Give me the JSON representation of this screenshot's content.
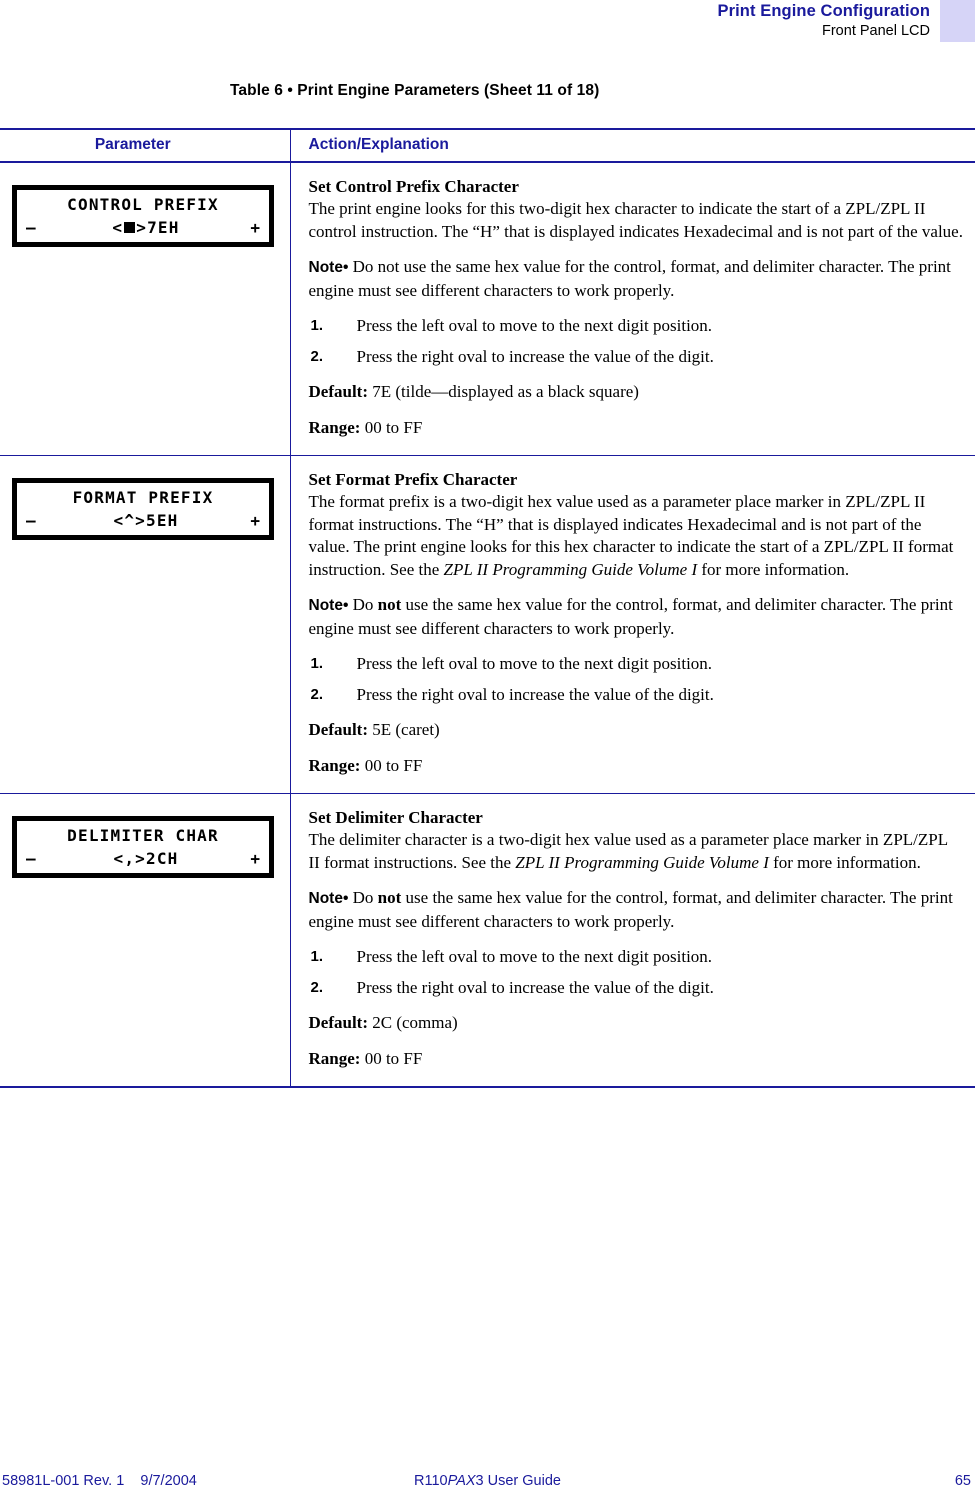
{
  "header": {
    "title": "Print Engine Configuration",
    "subtitle": "Front Panel LCD",
    "swatch_color": "#d6d4f7"
  },
  "table_caption": "Table 6 • Print Engine Parameters (Sheet 11 of 18)",
  "table": {
    "columns": {
      "parameter": "Parameter",
      "action": "Action/Explanation"
    },
    "accent_color": "#1a1a9c",
    "rows": [
      {
        "lcd": {
          "line1": "CONTROL PREFIX",
          "minus": "–",
          "plus": "+",
          "value_prefix": "<",
          "value_glyph": "black-square",
          "value_suffix": ">7EH"
        },
        "section_title": "Set Control Prefix Character",
        "description": "The print engine looks for this two-digit hex character to indicate the start of a ZPL/ZPL II control instruction. The “H” that is displayed indicates Hexadecimal and is not part of the value.",
        "note_label": "Note",
        "note_bullet": "•",
        "note_text_a": "Do not use the same hex value for the control, format, and delimiter character. The print engine must see different characters to work properly.",
        "note_bold_word": "",
        "note_text_b": "",
        "steps": [
          {
            "num": "1.",
            "text": "Press the left oval to move to the next digit position."
          },
          {
            "num": "2.",
            "text": "Press the right oval to increase the value of the digit."
          }
        ],
        "default_label": "Default:",
        "default_value": "7E (tilde—displayed as a black square)",
        "range_label": "Range:",
        "range_value": "00 to FF"
      },
      {
        "lcd": {
          "line1": "FORMAT PREFIX",
          "minus": "–",
          "plus": "+",
          "value_prefix": "<^>5EH",
          "value_glyph": "none",
          "value_suffix": ""
        },
        "section_title": "Set Format Prefix Character",
        "description_a": "The format prefix is a two-digit hex value used as a parameter place marker in ZPL/ZPL II format instructions. The “H” that is displayed indicates Hexadecimal and is not part of the value. The print engine looks for this hex character to indicate the start of a ZPL/ZPL II format instruction. See the ",
        "description_italic": "ZPL II Programming Guide Volume I",
        "description_b": " for more information.",
        "note_label": "Note",
        "note_bullet": "•",
        "note_text_a": "Do ",
        "note_bold_word": "not",
        "note_text_b": " use the same hex value for the control, format, and delimiter character. The print engine must see different characters to work properly.",
        "steps": [
          {
            "num": "1.",
            "text": "Press the left oval to move to the next digit position."
          },
          {
            "num": "2.",
            "text": "Press the right oval to increase the value of the digit."
          }
        ],
        "default_label": "Default:",
        "default_value": "5E (caret)",
        "range_label": "Range:",
        "range_value": "00 to FF"
      },
      {
        "lcd": {
          "line1": "DELIMITER CHAR",
          "minus": "–",
          "plus": "+",
          "value_prefix": "<,>2CH",
          "value_glyph": "none",
          "value_suffix": ""
        },
        "section_title": "Set Delimiter Character",
        "description_a": "The delimiter character is a two-digit hex value used as a parameter place marker in ZPL/ZPL II format instructions. See the ",
        "description_italic": "ZPL II Programming Guide Volume I",
        "description_b": " for more information.",
        "note_label": "Note",
        "note_bullet": "•",
        "note_text_a": "Do ",
        "note_bold_word": "not",
        "note_text_b": " use the same hex value for the control, format, and delimiter character. The print engine must see different characters to work properly.",
        "steps": [
          {
            "num": "1.",
            "text": "Press the left oval to move to the next digit position."
          },
          {
            "num": "2.",
            "text": "Press the right oval to increase the value of the digit."
          }
        ],
        "default_label": "Default:",
        "default_value": "2C (comma)",
        "range_label": "Range:",
        "range_value": "00 to FF"
      }
    ]
  },
  "footer": {
    "left": "58981L-001 Rev. 1    9/7/2004",
    "center_a": "R110",
    "center_italic": "PAX",
    "center_b": "3 User Guide",
    "page_number": "65"
  }
}
